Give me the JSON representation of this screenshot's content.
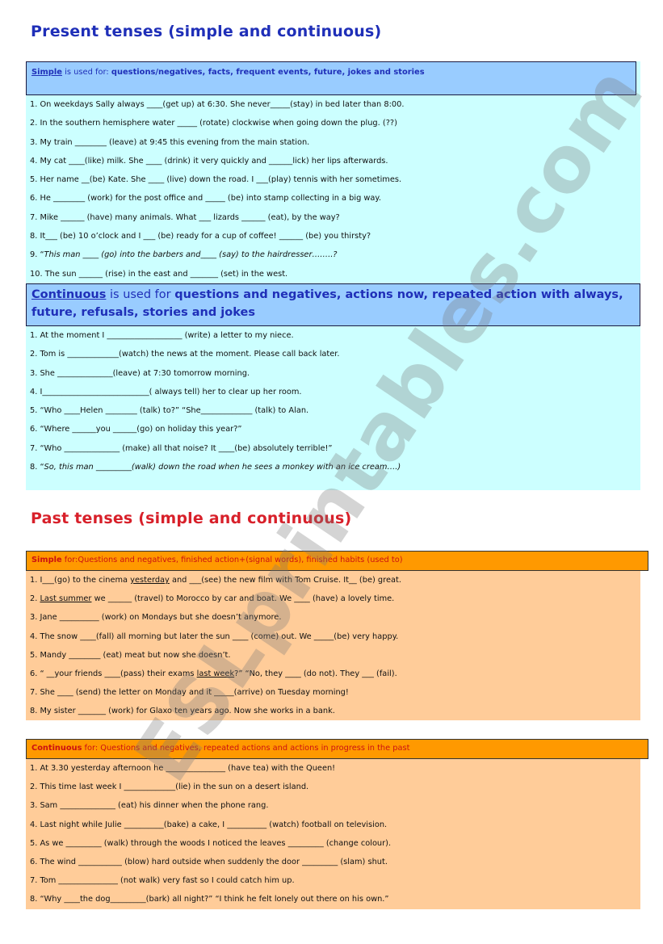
{
  "present": {
    "title": "Present tenses (simple and continuous)",
    "simple_header": {
      "key": "Simple",
      "lead": " is used for: ",
      "uses": "questions/negatives, facts, frequent events, future, jokes and stories"
    },
    "simple_items": [
      "1. On weekdays Sally always ____(get up) at 6:30. She never_____(stay) in bed later than 8:00.",
      "2. In the southern hemisphere water _____ (rotate) clockwise when going down the plug. (??)",
      "3. My train ________ (leave) at 9:45 this evening from the main station.",
      "4. My cat ____(like) milk. She ____ (drink) it very quickly and ______lick) her lips afterwards.",
      "5. Her name __(be) Kate. She ____ (live) down the road. I ___(play) tennis with her sometimes.",
      "6. He ________ (work) for the post office and _____ (be) into stamp collecting in a big way.",
      "7. Mike ______ (have) many animals. What ___ lizards ______ (eat), by the way?",
      "8. It___ (be) 10 o’clock and I ___ (be) ready for a cup of coffee! ______ (be) you thirsty?"
    ],
    "simple_item_9": {
      "num": "9. “",
      "text": "This man ____ (go) into the barbers and____ (say) to the hairdresser……..?"
    },
    "simple_item_10": "10. The sun ______ (rise) in the east and _______ (set) in the west.",
    "continuous_header": {
      "key": "Continuous",
      "lead": " is used for ",
      "uses": "questions and negatives, actions now, repeated action with always, future, refusals, stories and jokes"
    },
    "continuous_items": [
      "1.  At the moment I ___________________ (write) a letter to my niece.",
      "2. Tom is _____________(watch) the news at the moment. Please call back later.",
      "3. She ______________(leave) at 7:30 tomorrow morning.",
      "4. I___________________________( always tell) her to clear up her room.",
      "5. “Who ____Helen ________ (talk) to?” “She_____________ (talk) to Alan.",
      "6. “Where ______you ______(go) on holiday this year?”",
      "7. “Who ______________ (make) all that noise? It ____(be) absolutely terrible!”"
    ],
    "continuous_item_8": {
      "num": "8. “",
      "text": "So, this man _________(walk) down the road when he sees a monkey with an ice cream….)"
    }
  },
  "past": {
    "title": "Past tenses (simple and continuous)",
    "simple_header": {
      "key": "Simple",
      "text": " for:Questions and negatives, finished action+(signal words), finished habits (used to)"
    },
    "simple_items": [
      {
        "pre": "1. I___(go) to the cinema ",
        "ul": "yesterday",
        "post": " and ___(see) the new film with Tom Cruise. It__ (be) great."
      },
      {
        "pre": "2. ",
        "ul": "Last summer",
        "post": " we ______ (travel) to Morocco by car and boat. We ____ (have) a lovely time."
      },
      {
        "pre": "3. Jane __________ (work) on Mondays but she doesn’t anymore.",
        "ul": "",
        "post": ""
      },
      {
        "pre": "4. The snow ____(fall) all morning but later the sun ____ (come) out. We _____(be) very happy.",
        "ul": "",
        "post": ""
      },
      {
        "pre": "5. Mandy ________ (eat) meat but now she doesn’t.",
        "ul": "",
        "post": ""
      },
      {
        "pre": "6. “ __your friends ____(pass) their exams ",
        "ul": "last week",
        "post": "?” “No, they ____ (do not). They ___ (fail)."
      },
      {
        "pre": "7. She ____ (send) the letter on Monday and it _____(arrive) on Tuesday morning!",
        "ul": "",
        "post": ""
      },
      {
        "pre": "8. My sister _______ (work) for Glaxo ten years ago. Now she works in a bank.",
        "ul": "",
        "post": ""
      }
    ],
    "continuous_header": {
      "key": "Continuous",
      "text": " for: Questions and negatives, repeated actions and actions in progress in the past"
    },
    "continuous_items": [
      "1. At 3.30 yesterday afternoon he _______________ (have tea) with the Queen!",
      "2. This time last week I _____________(lie) in the sun on a desert island.",
      "3. Sam ______________ (eat) his dinner when the phone rang.",
      "4. Last night while Julie __________(bake) a cake, I __________ (watch) football on television.",
      "5. As we _________ (walk) through the woods I noticed the leaves _________ (change colour).",
      "6. The wind ___________ (blow) hard outside when suddenly the door _________ (slam) shut.",
      "7. Tom _______________ (not walk) very fast so I could catch him up.",
      "8. “Why ____the dog_________(bark) all night?” “I think he felt lonely out there on his own.”"
    ]
  },
  "watermark": "ESLprintables.com",
  "colors": {
    "present_title": "#1f2fb8",
    "past_title": "#d8202a",
    "present_box": "#ccffff",
    "present_header": "#99ccff",
    "past_box": "#ffcc99",
    "past_header": "#ff9900"
  }
}
